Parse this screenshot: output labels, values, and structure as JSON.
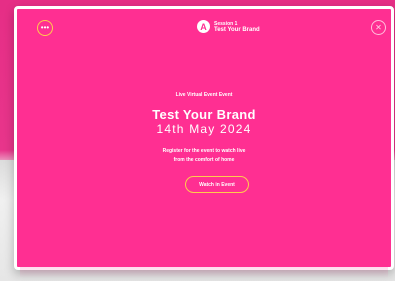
{
  "header": {
    "menu_icon": "more-dots-icon",
    "brand_small": "Session 1",
    "brand_title": "Test Your Brand",
    "close_icon": "close-icon"
  },
  "main": {
    "eyebrow": "Live Virtual Event Event",
    "title": "Test Your Brand",
    "date": "14th May 2024",
    "description_line1": "Register for the event to watch live",
    "description_line2": "from the comfort of home",
    "cta_label": "Watch in Event"
  },
  "colors": {
    "card_bg": "#ff2f92",
    "accent": "#ffcc4d",
    "text": "#ffffff"
  }
}
